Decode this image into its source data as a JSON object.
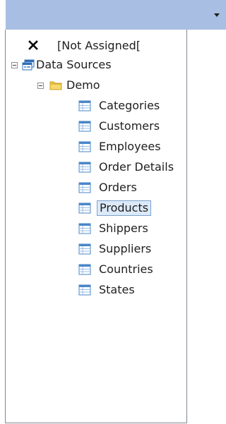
{
  "combo": {
    "value": "",
    "arrow_icon": "dropdown-arrow-icon"
  },
  "tree": {
    "not_assigned": {
      "label": "[Not Assigned[",
      "icon": "x-icon"
    },
    "root": {
      "label": "Data Sources",
      "icon": "data-sources-icon",
      "expanded": true,
      "children": [
        {
          "label": "Demo",
          "icon": "folder-icon",
          "expanded": true,
          "tables": [
            {
              "label": "Categories"
            },
            {
              "label": "Customers"
            },
            {
              "label": "Employees"
            },
            {
              "label": "Order Details"
            },
            {
              "label": "Orders"
            },
            {
              "label": "Products",
              "selected": true
            },
            {
              "label": "Shippers"
            },
            {
              "label": "Suppliers"
            },
            {
              "label": "Countries"
            },
            {
              "label": "States"
            }
          ]
        }
      ]
    }
  },
  "colors": {
    "combo_background": "#a8bfe3",
    "selection_fill": "#dce9f8",
    "selection_border": "#7da2ce",
    "panel_border": "#828790",
    "folder": "#f2c94c",
    "table_icon_blue": "#4a86c8"
  }
}
